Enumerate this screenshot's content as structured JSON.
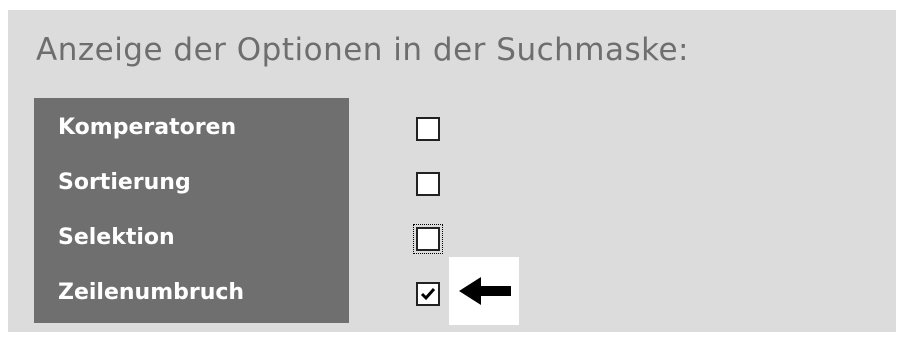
{
  "section": {
    "title": "Anzeige der Optionen in der Suchmaske:"
  },
  "options": [
    {
      "label": "Komperatoren",
      "checked": false,
      "focused": false
    },
    {
      "label": "Sortierung",
      "checked": false,
      "focused": false
    },
    {
      "label": "Selektion",
      "checked": false,
      "focused": true
    },
    {
      "label": "Zeilenumbruch",
      "checked": true,
      "focused": false
    }
  ],
  "annotation": {
    "icon": "arrow-left-icon"
  },
  "colors": {
    "panel_background": "#dcdcdc",
    "label_column_background": "#6f6f6f",
    "title_text": "#6e6e6e",
    "label_text": "#ffffff"
  }
}
